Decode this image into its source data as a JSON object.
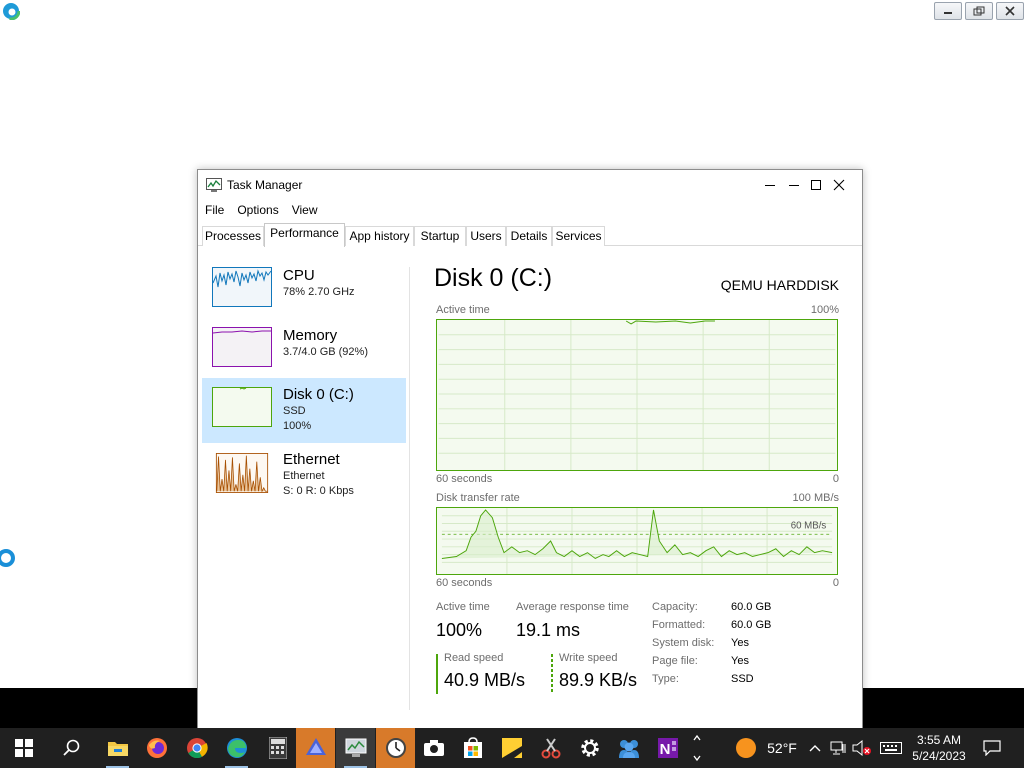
{
  "window": {
    "title": "Task Manager",
    "menu": [
      "File",
      "Options",
      "View"
    ],
    "tabs": [
      "Processes",
      "Performance",
      "App history",
      "Startup",
      "Users",
      "Details",
      "Services"
    ],
    "active_tab": "Performance"
  },
  "sidebar": {
    "items": [
      {
        "title": "CPU",
        "sub1": "78%  2.70 GHz",
        "sub2": ""
      },
      {
        "title": "Memory",
        "sub1": "3.7/4.0 GB (92%)",
        "sub2": ""
      },
      {
        "title": "Disk 0 (C:)",
        "sub1": "SSD",
        "sub2": "100%"
      },
      {
        "title": "Ethernet",
        "sub1": "Ethernet",
        "sub2": "S: 0  R: 0 Kbps"
      }
    ],
    "selected": "Disk 0 (C:)"
  },
  "detail": {
    "title": "Disk 0 (C:)",
    "model": "QEMU HARDDISK",
    "active_graph": {
      "label": "Active time",
      "max_label": "100%",
      "time_label": "60 seconds",
      "min_label": "0"
    },
    "transfer_graph": {
      "label": "Disk transfer rate",
      "max_label": "100 MB/s",
      "mid_label": "60 MB/s",
      "time_label": "60 seconds",
      "min_label": "0"
    },
    "stats": {
      "active_time_label": "Active time",
      "active_time_value": "100%",
      "avg_response_label": "Average response time",
      "avg_response_value": "19.1 ms",
      "read_speed_label": "Read speed",
      "read_speed_value": "40.9 MB/s",
      "write_speed_label": "Write speed",
      "write_speed_value": "89.9 KB/s"
    },
    "properties": [
      {
        "key": "Capacity:",
        "value": "60.0 GB"
      },
      {
        "key": "Formatted:",
        "value": "60.0 GB"
      },
      {
        "key": "System disk:",
        "value": "Yes"
      },
      {
        "key": "Page file:",
        "value": "Yes"
      },
      {
        "key": "Type:",
        "value": "SSD"
      }
    ]
  },
  "colors": {
    "disk_accent": "#4da60c",
    "cpu_accent": "#1177bb",
    "memory_accent": "#8b12ae",
    "ethernet_accent": "#a74f01",
    "selected_bg": "#cce8ff"
  },
  "taskbar": {
    "apps": [
      "start-icon",
      "search-icon",
      "file-explorer-icon",
      "firefox-icon",
      "chrome-icon",
      "edge-icon",
      "calculator-icon",
      "app-icon",
      "task-manager-icon",
      "clock-icon",
      "camera-icon",
      "store-icon",
      "sticky-notes-icon",
      "snipping-tool-icon",
      "settings-icon",
      "people-icon",
      "onenote-icon"
    ],
    "weather_temp": "52°F",
    "time": "3:55 AM",
    "date": "5/24/2023"
  }
}
